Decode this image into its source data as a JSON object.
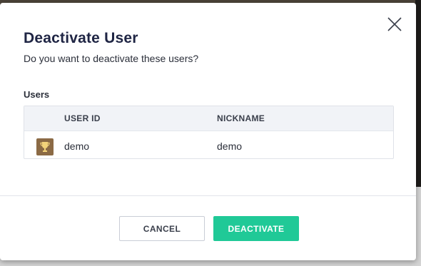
{
  "dialog": {
    "title": "Deactivate User",
    "subtitle": "Do you want to deactivate these users?",
    "close_icon": "close-icon"
  },
  "users_section": {
    "label": "Users",
    "columns": [
      "USER ID",
      "NICKNAME"
    ],
    "rows": [
      {
        "avatar_icon": "trophy-icon",
        "user_id": "demo",
        "nickname": "demo"
      }
    ]
  },
  "actions": {
    "cancel_label": "CANCEL",
    "deactivate_label": "DEACTIVATE"
  },
  "colors": {
    "accent": "#20c997",
    "title": "#1f2544",
    "avatar_bg": "#8b6a45"
  }
}
